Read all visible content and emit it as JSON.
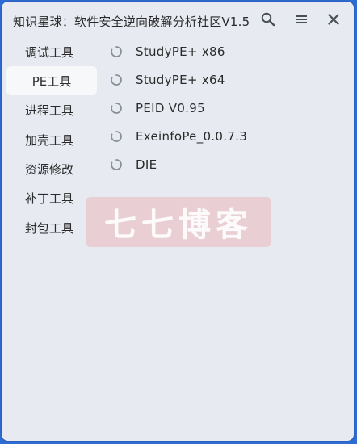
{
  "window": {
    "title": "知识星球：软件安全逆向破解分析社区V1.5"
  },
  "titlebar": {
    "buttons": [
      {
        "icon": "search-icon"
      },
      {
        "icon": "menu-icon"
      },
      {
        "icon": "close-icon"
      }
    ]
  },
  "sidebar": {
    "items": [
      {
        "label": "调试工具",
        "active": false
      },
      {
        "label": "PE工具",
        "active": true
      },
      {
        "label": "进程工具",
        "active": false
      },
      {
        "label": "加壳工具",
        "active": false
      },
      {
        "label": "资源修改",
        "active": false
      },
      {
        "label": "补丁工具",
        "active": false
      },
      {
        "label": "封包工具",
        "active": false
      }
    ]
  },
  "tools": {
    "items": [
      {
        "label": "StudyPE+ x86",
        "icon": "loading-spinner-icon"
      },
      {
        "label": "StudyPE+ x64",
        "icon": "loading-spinner-icon"
      },
      {
        "label": "PEID V0.95",
        "icon": "loading-spinner-icon"
      },
      {
        "label": "ExeinfoPe_0.0.7.3",
        "icon": "loading-spinner-icon"
      },
      {
        "label": "DIE",
        "icon": "loading-spinner-icon"
      }
    ]
  },
  "watermark": {
    "text": "七七博客"
  },
  "colors": {
    "window_bg": "#e7ebf1",
    "frame": "#2e6bd3",
    "active_item_bg": "#f7f8fa",
    "watermark_bg": "#eaaab2"
  }
}
